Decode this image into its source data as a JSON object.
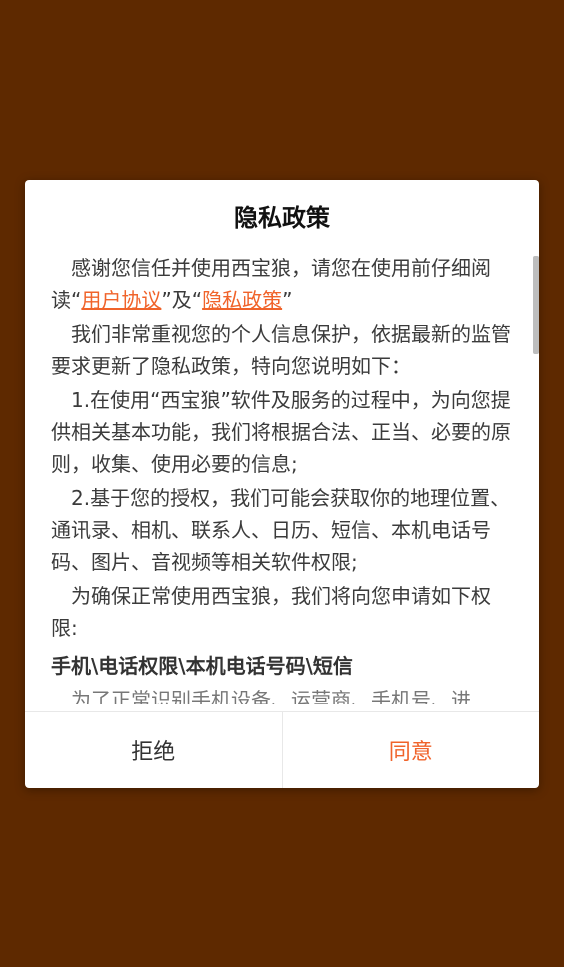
{
  "dialog": {
    "title": "隐私政策",
    "intro_part1": "感谢您信任并使用西宝狼，请您在使用前仔细阅读“",
    "user_agreement_link": "用户协议",
    "intro_part2": "”及“",
    "privacy_policy_link": "隐私政策",
    "intro_part3": "”",
    "para2": "我们非常重视您的个人信息保护，依据最新的监管要求更新了隐私政策，特向您说明如下：",
    "para3": "1.在使用“西宝狼”软件及服务的过程中，为向您提供相关基本功能，我们将根据合法、正当、必要的原则，收集、使用必要的信息;",
    "para4": "2.基于您的授权，我们可能会获取你的地理位置、通讯录、相机、联系人、日历、短信、本机电话号码、图片、音视频等相关软件权限;",
    "para5": "为确保正常使用西宝狼，我们将向您申请如下权限:",
    "permissions_heading": "手机\\电话权限\\本机电话号码\\短信",
    "cut_text": "为了正常识别手机设备、运营商、手机号、进"
  },
  "buttons": {
    "reject_label": "拒绝",
    "accept_label": "同意"
  },
  "colors": {
    "background": "#5e2900",
    "accent": "#f0632a",
    "dialog": "#ffffff"
  }
}
